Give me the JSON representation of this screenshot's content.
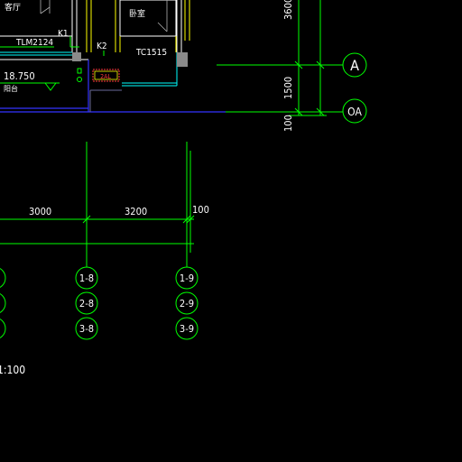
{
  "drawing": {
    "room_labels": {
      "left_room": "客厅",
      "right_room": "卧室",
      "balcony": "阳台"
    },
    "window_door_tags": {
      "tlm": "TLM2124",
      "k1": "K1",
      "k2": "K2",
      "tc": "TC1515",
      "unit_box": "2AL"
    },
    "elevation": "18.750",
    "grid_axes": {
      "a": "A",
      "oa": "OA"
    },
    "right_dims": {
      "d3600": "3600",
      "d1500": "1500",
      "d100": "100"
    },
    "bottom_dims": {
      "d3000": "3000",
      "d3200": "3200",
      "d100": "100"
    },
    "axis_bubbles": {
      "col8": [
        "1-8",
        "2-8",
        "3-8"
      ],
      "col9": [
        "1-9",
        "2-9",
        "3-9"
      ]
    },
    "scale_text": "1:100"
  },
  "colors": {
    "background": "#000000",
    "dimension_lines": "#00ff00",
    "walls": "#ffffff",
    "window_yellow": "#ffff00",
    "slab_blue": "#3333ff",
    "cyan_lines": "#00ffff",
    "unit_box_red": "#ff3b3b"
  }
}
